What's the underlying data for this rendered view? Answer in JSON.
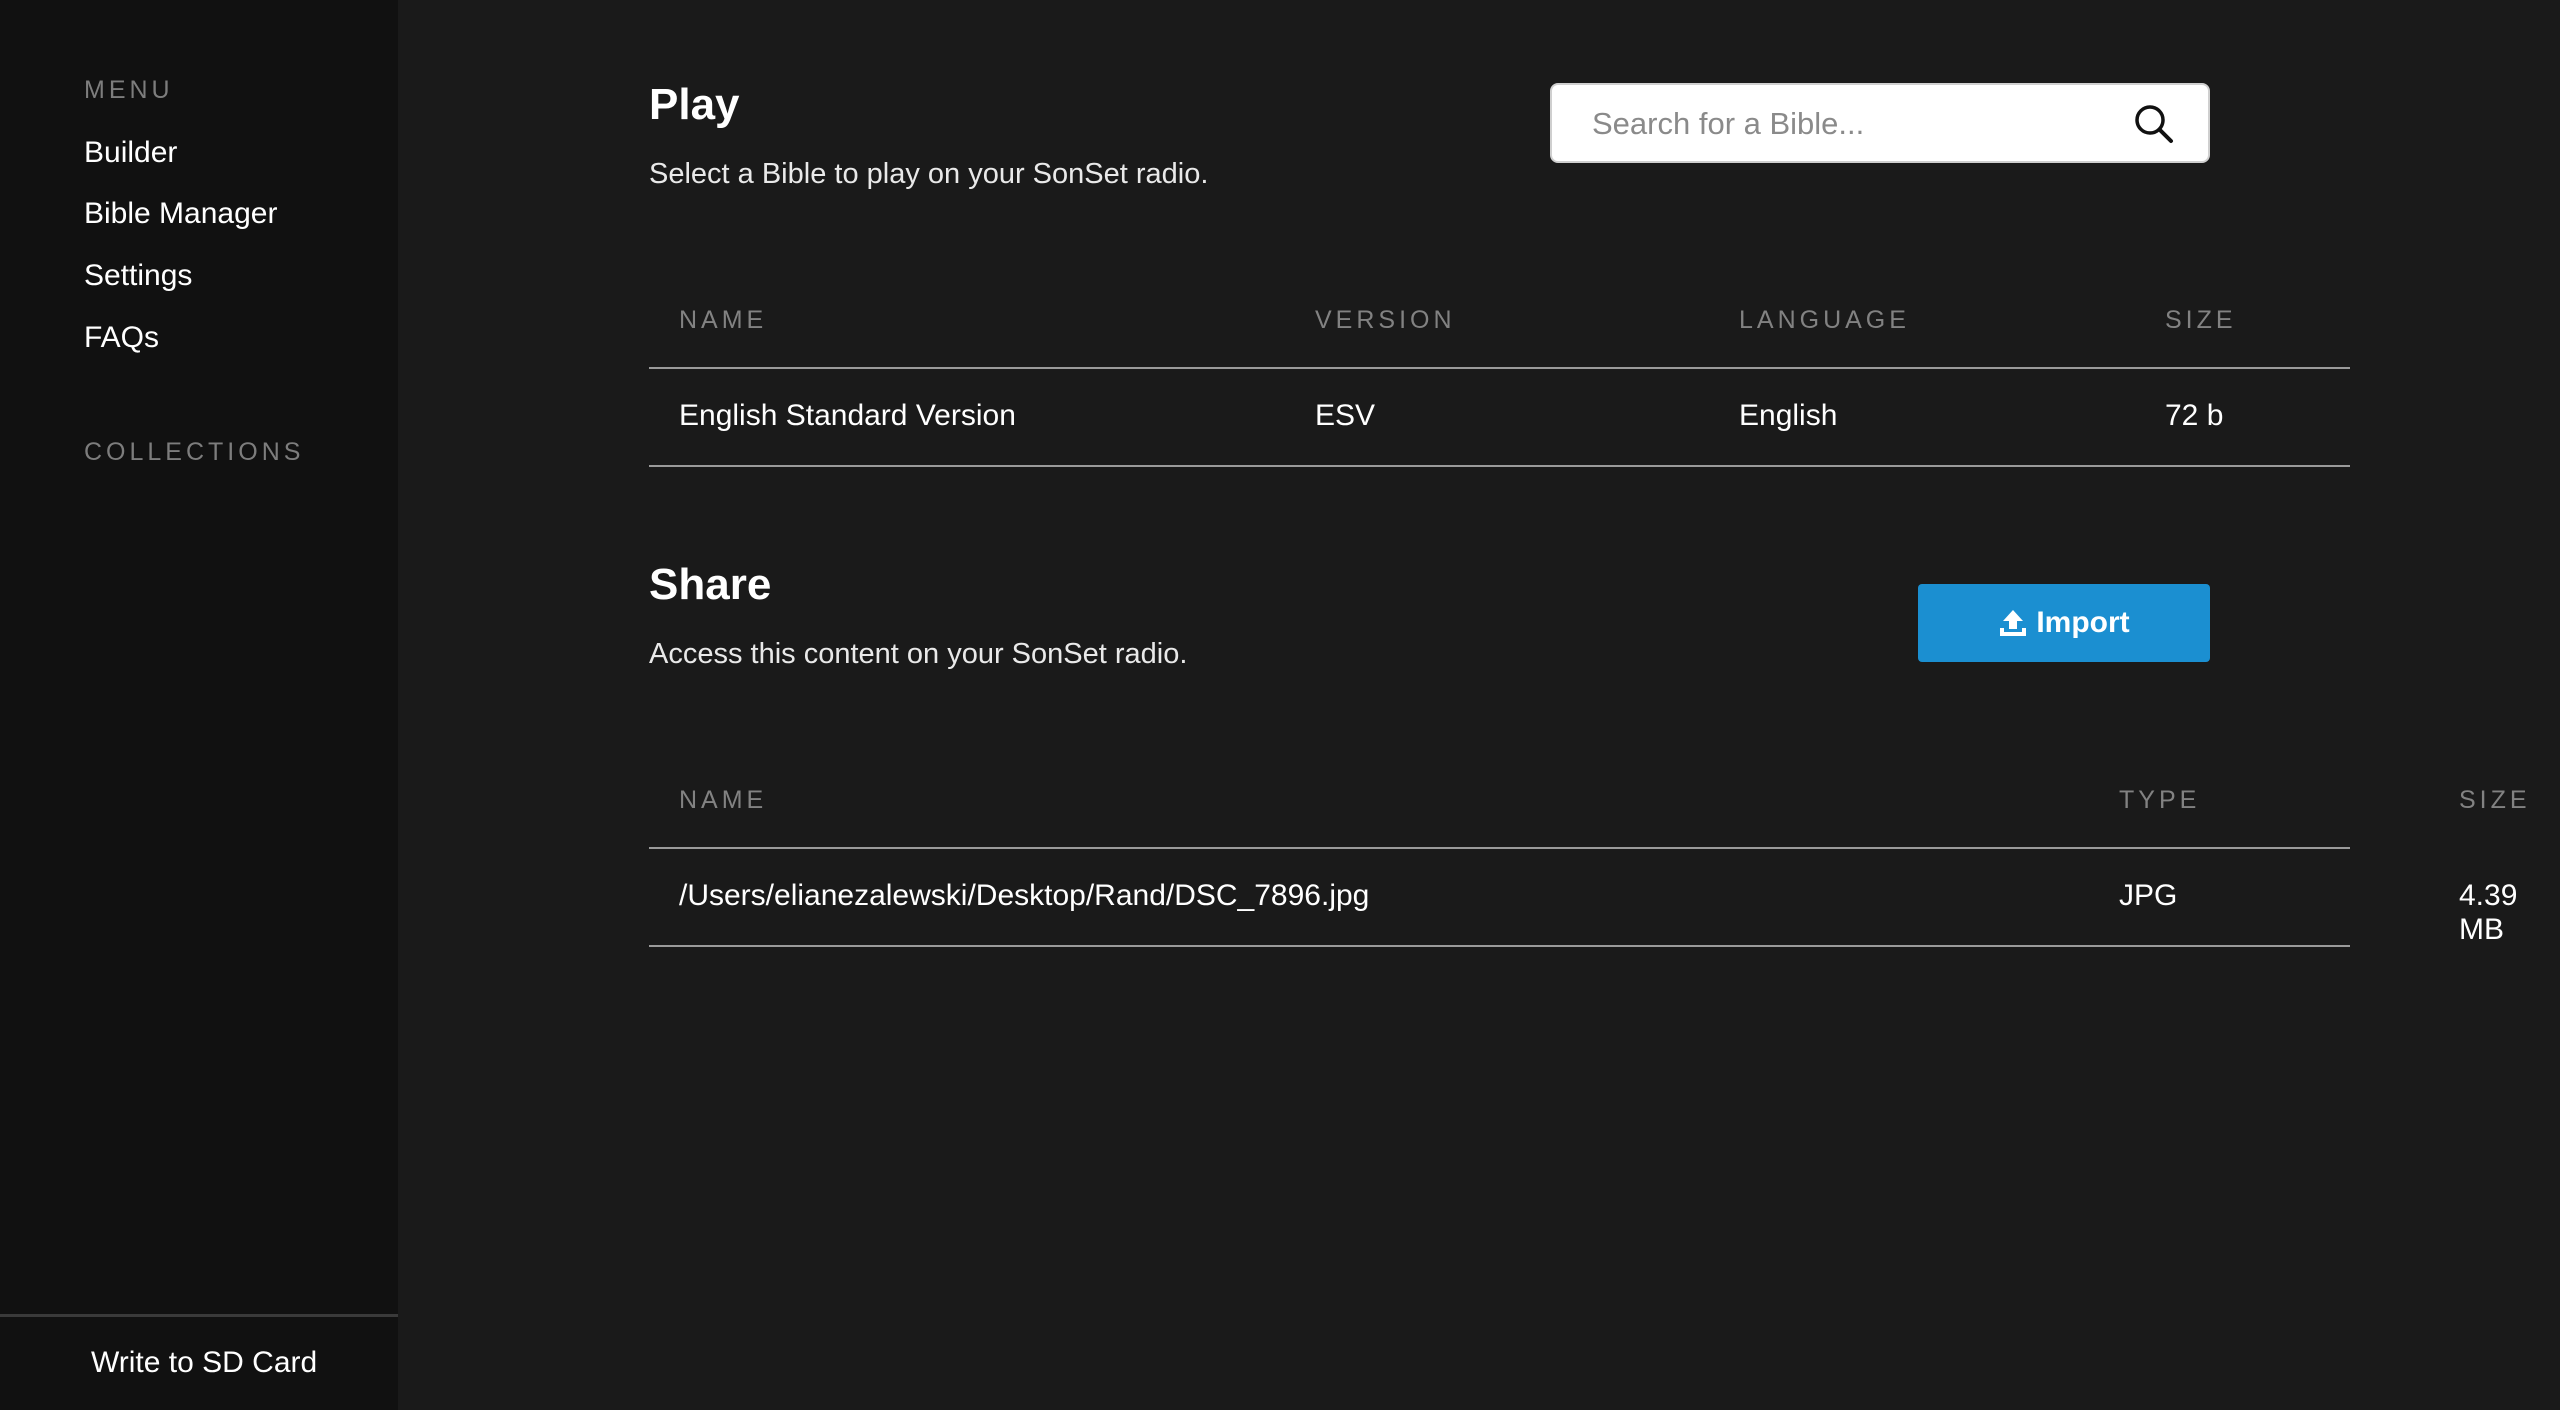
{
  "sidebar": {
    "menu_heading": "MENU",
    "items": [
      {
        "label": "Builder"
      },
      {
        "label": "Bible Manager"
      },
      {
        "label": "Settings"
      },
      {
        "label": "FAQs"
      }
    ],
    "collections_heading": "COLLECTIONS",
    "footer_label": "Write to SD Card"
  },
  "play": {
    "title": "Play",
    "subtitle": "Select a Bible to play on your SonSet radio.",
    "search": {
      "placeholder": "Search for a Bible...",
      "value": ""
    },
    "columns": [
      "NAME",
      "VERSION",
      "LANGUAGE",
      "SIZE"
    ],
    "rows": [
      {
        "name": "English Standard Version",
        "version": "ESV",
        "language": "English",
        "size": "72 b"
      }
    ]
  },
  "share": {
    "title": "Share",
    "subtitle": "Access this content on your SonSet radio.",
    "import_label": "Import",
    "columns": [
      "NAME",
      "TYPE",
      "SIZE"
    ],
    "rows": [
      {
        "name": "/Users/elianezalewski/Desktop/Rand/DSC_7896.jpg",
        "type": "JPG",
        "size": "4.39 MB"
      }
    ]
  },
  "colors": {
    "background": "#1a1a1a",
    "sidebar": "#111111",
    "accent": "#1b8fd1",
    "muted_text": "#828282"
  },
  "icons": {
    "search": "search-icon",
    "import": "upload-icon"
  }
}
